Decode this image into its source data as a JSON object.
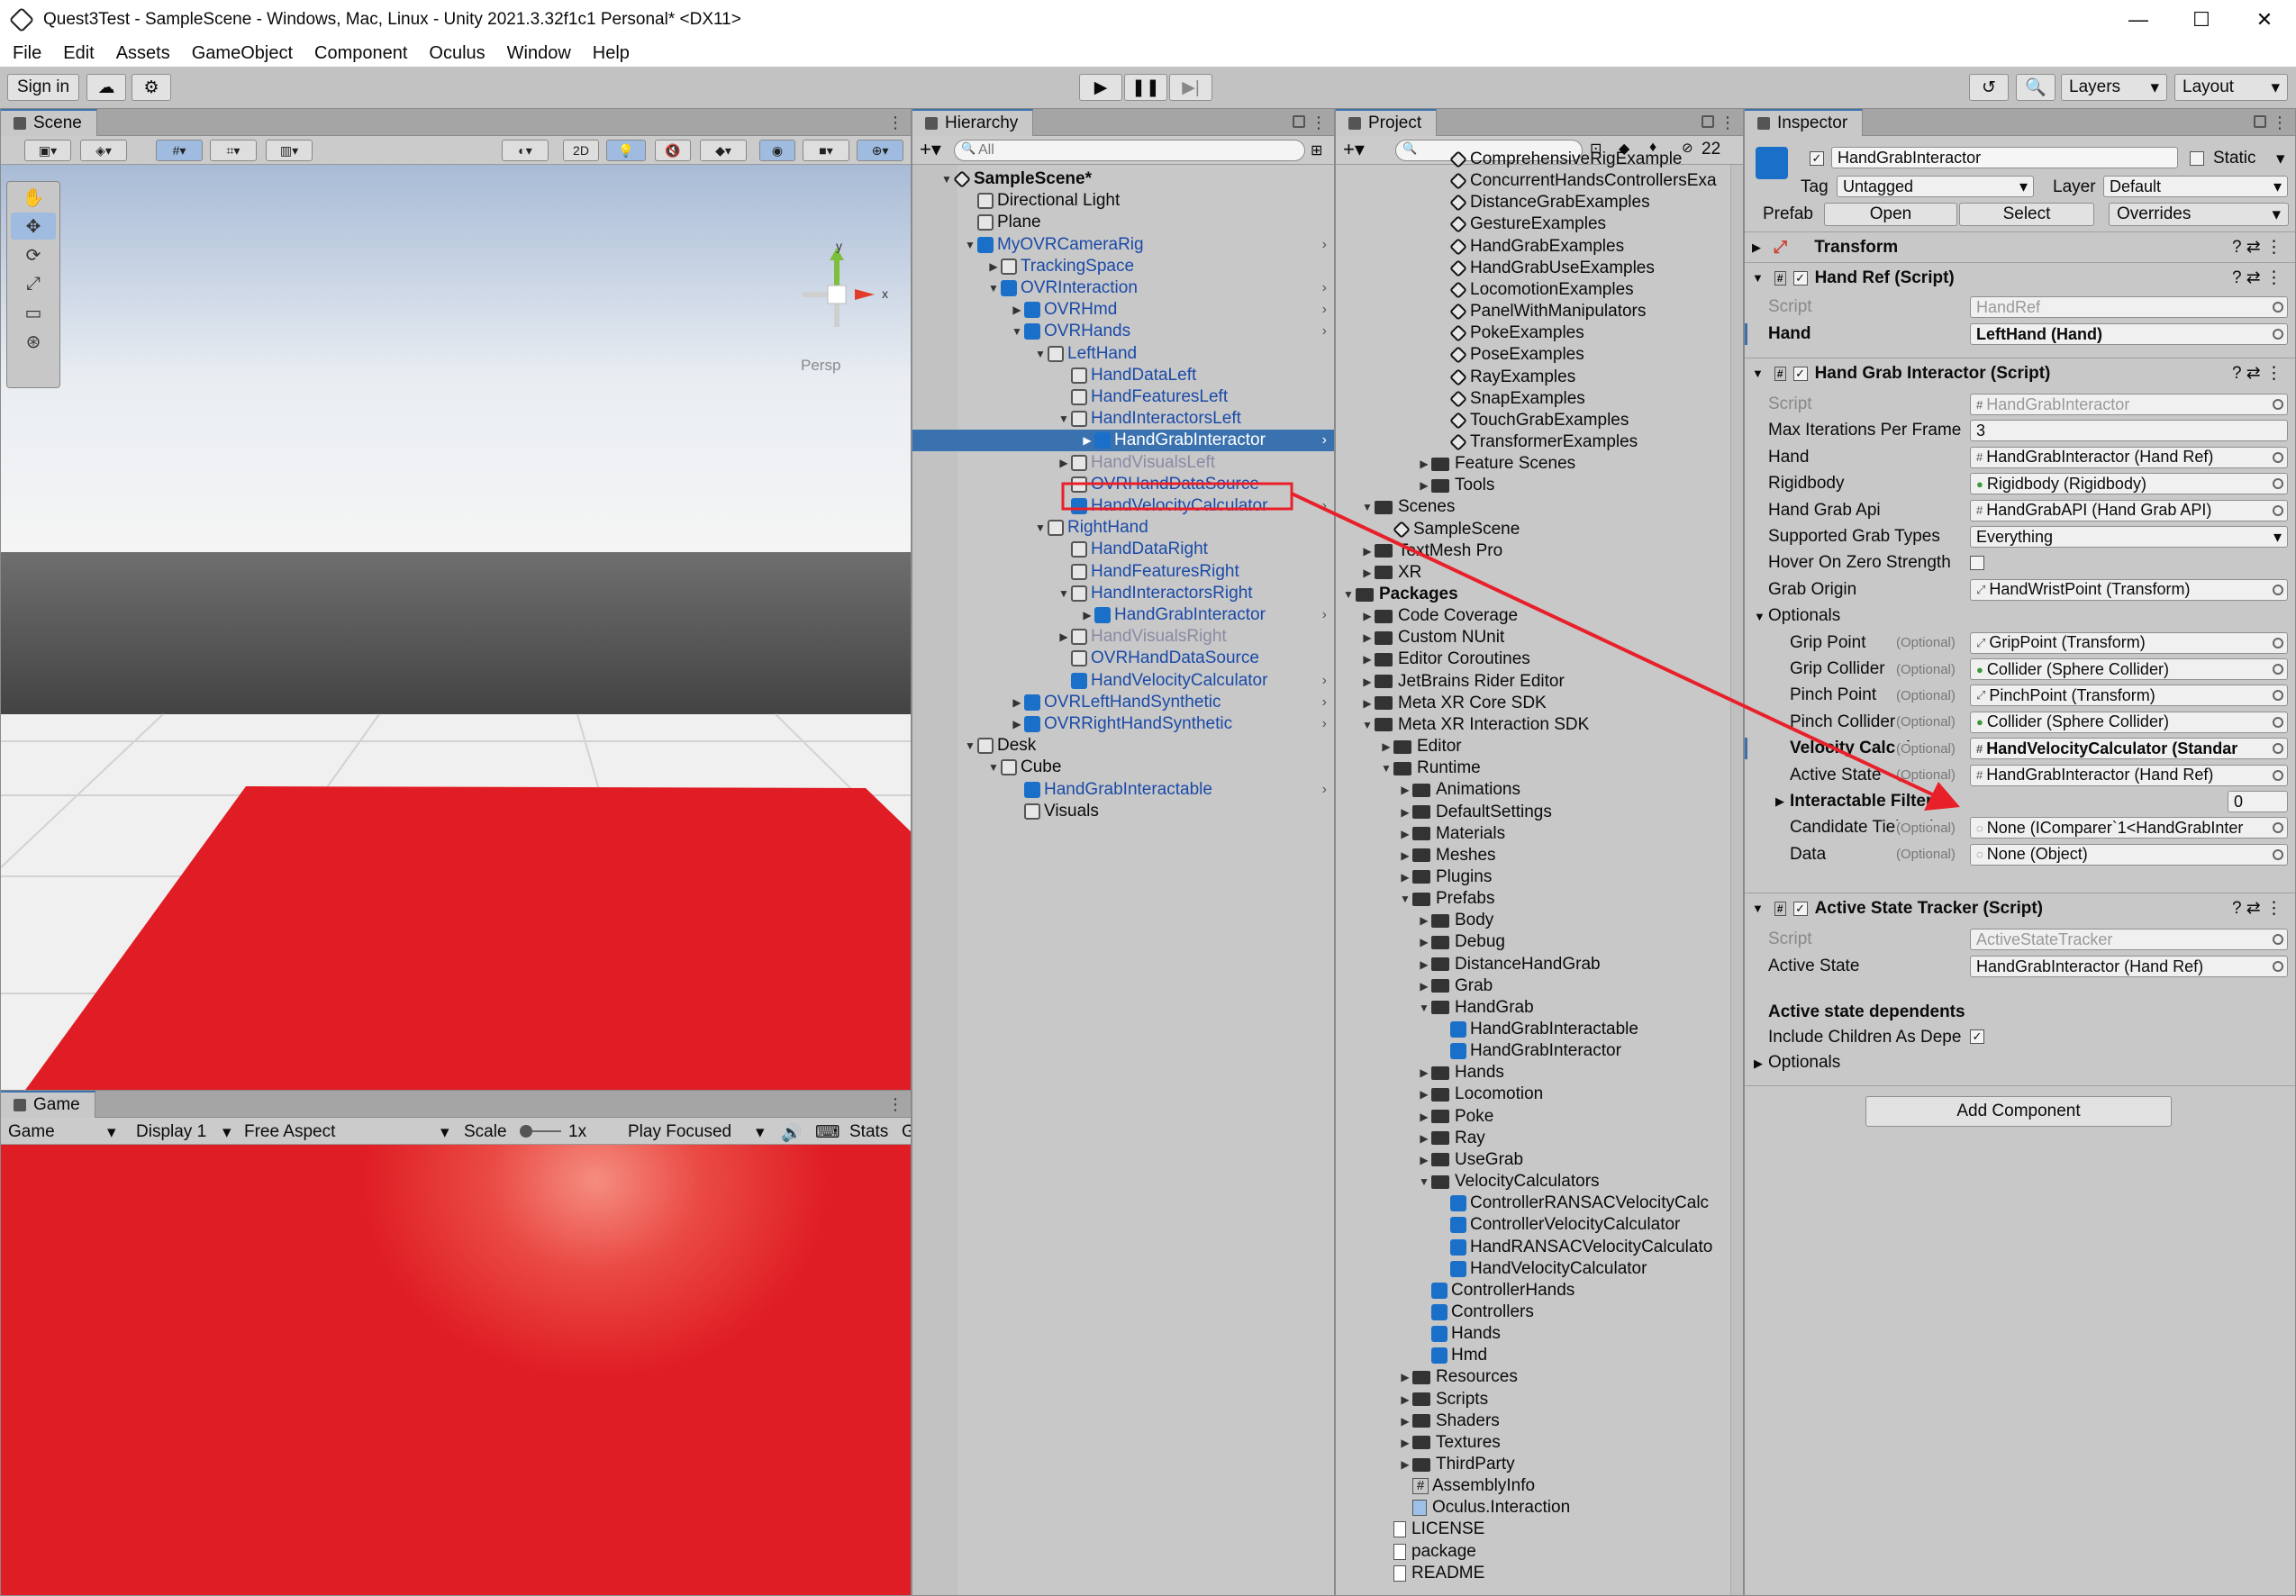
{
  "window": {
    "title": "Quest3Test - SampleScene - Windows, Mac, Linux - Unity 2021.3.32f1c1 Personal* <DX11>"
  },
  "menu": [
    "File",
    "Edit",
    "Assets",
    "GameObject",
    "Component",
    "Oculus",
    "Window",
    "Help"
  ],
  "toolbar": {
    "sign_in": "Sign in",
    "layers": "Layers",
    "layout": "Layout"
  },
  "scene": {
    "tab": "Scene",
    "mode_2d": "2D",
    "persp": "Persp",
    "axis_y": "y",
    "axis_x": "x"
  },
  "game": {
    "tab": "Game",
    "mode": "Game",
    "display": "Display 1",
    "aspect": "Free Aspect",
    "scale_label": "Scale",
    "scale_value": "1x",
    "play_focused": "Play Focused",
    "stats": "Stats",
    "gizmos": "G"
  },
  "hierarchy": {
    "tab": "Hierarchy",
    "search_placeholder": "All",
    "rows": [
      {
        "label": "SampleScene*",
        "indent": 0,
        "arrow": "▼",
        "icon": "unity",
        "style": "bold"
      },
      {
        "label": "Directional Light",
        "indent": 1,
        "arrow": "",
        "icon": "gobj",
        "style": ""
      },
      {
        "label": "Plane",
        "indent": 1,
        "arrow": "",
        "icon": "gobj",
        "style": ""
      },
      {
        "label": "MyOVRCameraRig",
        "indent": 1,
        "arrow": "▼",
        "icon": "cube",
        "style": "blue",
        "more": true
      },
      {
        "label": "TrackingSpace",
        "indent": 2,
        "arrow": "▶",
        "icon": "gobj",
        "style": "blue"
      },
      {
        "label": "OVRInteraction",
        "indent": 2,
        "arrow": "▼",
        "icon": "cube",
        "style": "blue",
        "more": true
      },
      {
        "label": "OVRHmd",
        "indent": 3,
        "arrow": "▶",
        "icon": "cube",
        "style": "blue",
        "more": true
      },
      {
        "label": "OVRHands",
        "indent": 3,
        "arrow": "▼",
        "icon": "cube",
        "style": "blue",
        "more": true
      },
      {
        "label": "LeftHand",
        "indent": 4,
        "arrow": "▼",
        "icon": "gobj",
        "style": "blue"
      },
      {
        "label": "HandDataLeft",
        "indent": 5,
        "arrow": "",
        "icon": "gobj",
        "style": "blue"
      },
      {
        "label": "HandFeaturesLeft",
        "indent": 5,
        "arrow": "",
        "icon": "gobj",
        "style": "blue"
      },
      {
        "label": "HandInteractorsLeft",
        "indent": 5,
        "arrow": "▼",
        "icon": "gobj",
        "style": "blue"
      },
      {
        "label": "HandGrabInteractor",
        "indent": 6,
        "arrow": "▶",
        "icon": "cube",
        "style": "sel",
        "more": true
      },
      {
        "label": "HandVisualsLeft",
        "indent": 5,
        "arrow": "▶",
        "icon": "gobj",
        "style": "dim"
      },
      {
        "label": "OVRHandDataSource",
        "indent": 5,
        "arrow": "",
        "icon": "gobj",
        "style": "blue"
      },
      {
        "label": "HandVelocityCalculator",
        "indent": 5,
        "arrow": "",
        "icon": "cube",
        "style": "blue boxed",
        "more": true
      },
      {
        "label": "RightHand",
        "indent": 4,
        "arrow": "▼",
        "icon": "gobj",
        "style": "blue"
      },
      {
        "label": "HandDataRight",
        "indent": 5,
        "arrow": "",
        "icon": "gobj",
        "style": "blue"
      },
      {
        "label": "HandFeaturesRight",
        "indent": 5,
        "arrow": "",
        "icon": "gobj",
        "style": "blue"
      },
      {
        "label": "HandInteractorsRight",
        "indent": 5,
        "arrow": "▼",
        "icon": "gobj",
        "style": "blue"
      },
      {
        "label": "HandGrabInteractor",
        "indent": 6,
        "arrow": "▶",
        "icon": "cube",
        "style": "blue",
        "more": true
      },
      {
        "label": "HandVisualsRight",
        "indent": 5,
        "arrow": "▶",
        "icon": "gobj",
        "style": "dim"
      },
      {
        "label": "OVRHandDataSource",
        "indent": 5,
        "arrow": "",
        "icon": "gobj",
        "style": "blue"
      },
      {
        "label": "HandVelocityCalculator",
        "indent": 5,
        "arrow": "",
        "icon": "cube",
        "style": "blue",
        "more": true
      },
      {
        "label": "OVRLeftHandSynthetic",
        "indent": 3,
        "arrow": "▶",
        "icon": "cube",
        "style": "blue",
        "more": true
      },
      {
        "label": "OVRRightHandSynthetic",
        "indent": 3,
        "arrow": "▶",
        "icon": "cube",
        "style": "blue",
        "more": true
      },
      {
        "label": "Desk",
        "indent": 1,
        "arrow": "▼",
        "icon": "gobj",
        "style": ""
      },
      {
        "label": "Cube",
        "indent": 2,
        "arrow": "▼",
        "icon": "gobj",
        "style": ""
      },
      {
        "label": "HandGrabInteractable",
        "indent": 3,
        "arrow": "",
        "icon": "cube",
        "style": "blue",
        "more": true
      },
      {
        "label": "Visuals",
        "indent": 3,
        "arrow": "",
        "icon": "gobj",
        "style": ""
      }
    ]
  },
  "project": {
    "tab": "Project",
    "hidden_count": "22",
    "rows": [
      {
        "label": "ComprehensiveRigExample",
        "indent": 5,
        "icon": "unity",
        "arrow": ""
      },
      {
        "label": "ConcurrentHandsControllersExa",
        "indent": 5,
        "icon": "unity",
        "arrow": ""
      },
      {
        "label": "DistanceGrabExamples",
        "indent": 5,
        "icon": "unity",
        "arrow": ""
      },
      {
        "label": "GestureExamples",
        "indent": 5,
        "icon": "unity",
        "arrow": ""
      },
      {
        "label": "HandGrabExamples",
        "indent": 5,
        "icon": "unity",
        "arrow": ""
      },
      {
        "label": "HandGrabUseExamples",
        "indent": 5,
        "icon": "unity",
        "arrow": ""
      },
      {
        "label": "LocomotionExamples",
        "indent": 5,
        "icon": "unity",
        "arrow": ""
      },
      {
        "label": "PanelWithManipulators",
        "indent": 5,
        "icon": "unity",
        "arrow": ""
      },
      {
        "label": "PokeExamples",
        "indent": 5,
        "icon": "unity",
        "arrow": ""
      },
      {
        "label": "PoseExamples",
        "indent": 5,
        "icon": "unity",
        "arrow": ""
      },
      {
        "label": "RayExamples",
        "indent": 5,
        "icon": "unity",
        "arrow": ""
      },
      {
        "label": "SnapExamples",
        "indent": 5,
        "icon": "unity",
        "arrow": ""
      },
      {
        "label": "TouchGrabExamples",
        "indent": 5,
        "icon": "unity",
        "arrow": ""
      },
      {
        "label": "TransformerExamples",
        "indent": 5,
        "icon": "unity",
        "arrow": ""
      },
      {
        "label": "Feature Scenes",
        "indent": 4,
        "icon": "folder",
        "arrow": "▶"
      },
      {
        "label": "Tools",
        "indent": 4,
        "icon": "folder",
        "arrow": "▶"
      },
      {
        "label": "Scenes",
        "indent": 1,
        "icon": "folder",
        "arrow": "▼"
      },
      {
        "label": "SampleScene",
        "indent": 2,
        "icon": "unity",
        "arrow": ""
      },
      {
        "label": "TextMesh Pro",
        "indent": 1,
        "icon": "folder",
        "arrow": "▶"
      },
      {
        "label": "XR",
        "indent": 1,
        "icon": "folder",
        "arrow": "▶"
      },
      {
        "label": "Packages",
        "indent": 0,
        "icon": "folder",
        "arrow": "▼",
        "bold": true
      },
      {
        "label": "Code Coverage",
        "indent": 1,
        "icon": "folder",
        "arrow": "▶"
      },
      {
        "label": "Custom NUnit",
        "indent": 1,
        "icon": "folder",
        "arrow": "▶"
      },
      {
        "label": "Editor Coroutines",
        "indent": 1,
        "icon": "folder",
        "arrow": "▶"
      },
      {
        "label": "JetBrains Rider Editor",
        "indent": 1,
        "icon": "folder",
        "arrow": "▶"
      },
      {
        "label": "Meta XR Core SDK",
        "indent": 1,
        "icon": "folder",
        "arrow": "▶"
      },
      {
        "label": "Meta XR Interaction SDK",
        "indent": 1,
        "icon": "folder",
        "arrow": "▼"
      },
      {
        "label": "Editor",
        "indent": 2,
        "icon": "folder",
        "arrow": "▶"
      },
      {
        "label": "Runtime",
        "indent": 2,
        "icon": "folder",
        "arrow": "▼"
      },
      {
        "label": "Animations",
        "indent": 3,
        "icon": "folder",
        "arrow": "▶"
      },
      {
        "label": "DefaultSettings",
        "indent": 3,
        "icon": "folder",
        "arrow": "▶"
      },
      {
        "label": "Materials",
        "indent": 3,
        "icon": "folder",
        "arrow": "▶"
      },
      {
        "label": "Meshes",
        "indent": 3,
        "icon": "folder",
        "arrow": "▶"
      },
      {
        "label": "Plugins",
        "indent": 3,
        "icon": "folder",
        "arrow": "▶"
      },
      {
        "label": "Prefabs",
        "indent": 3,
        "icon": "folder",
        "arrow": "▼"
      },
      {
        "label": "Body",
        "indent": 4,
        "icon": "folder",
        "arrow": "▶"
      },
      {
        "label": "Debug",
        "indent": 4,
        "icon": "folder",
        "arrow": "▶"
      },
      {
        "label": "DistanceHandGrab",
        "indent": 4,
        "icon": "folder",
        "arrow": "▶"
      },
      {
        "label": "Grab",
        "indent": 4,
        "icon": "folder",
        "arrow": "▶"
      },
      {
        "label": "HandGrab",
        "indent": 4,
        "icon": "folder",
        "arrow": "▼"
      },
      {
        "label": "HandGrabInteractable",
        "indent": 5,
        "icon": "cube",
        "arrow": ""
      },
      {
        "label": "HandGrabInteractor",
        "indent": 5,
        "icon": "cube",
        "arrow": ""
      },
      {
        "label": "Hands",
        "indent": 4,
        "icon": "folder",
        "arrow": "▶"
      },
      {
        "label": "Locomotion",
        "indent": 4,
        "icon": "folder",
        "arrow": "▶"
      },
      {
        "label": "Poke",
        "indent": 4,
        "icon": "folder",
        "arrow": "▶"
      },
      {
        "label": "Ray",
        "indent": 4,
        "icon": "folder",
        "arrow": "▶"
      },
      {
        "label": "UseGrab",
        "indent": 4,
        "icon": "folder",
        "arrow": "▶"
      },
      {
        "label": "VelocityCalculators",
        "indent": 4,
        "icon": "folder",
        "arrow": "▼"
      },
      {
        "label": "ControllerRANSACVelocityCalc",
        "indent": 5,
        "icon": "cube",
        "arrow": ""
      },
      {
        "label": "ControllerVelocityCalculator",
        "indent": 5,
        "icon": "cube",
        "arrow": ""
      },
      {
        "label": "HandRANSACVelocityCalculato",
        "indent": 5,
        "icon": "cube",
        "arrow": ""
      },
      {
        "label": "HandVelocityCalculator",
        "indent": 5,
        "icon": "cube",
        "arrow": ""
      },
      {
        "label": "ControllerHands",
        "indent": 4,
        "icon": "cube",
        "arrow": ""
      },
      {
        "label": "Controllers",
        "indent": 4,
        "icon": "cube",
        "arrow": ""
      },
      {
        "label": "Hands",
        "indent": 4,
        "icon": "cube",
        "arrow": ""
      },
      {
        "label": "Hmd",
        "indent": 4,
        "icon": "cube",
        "arrow": ""
      },
      {
        "label": "Resources",
        "indent": 3,
        "icon": "folder",
        "arrow": "▶"
      },
      {
        "label": "Scripts",
        "indent": 3,
        "icon": "folder",
        "arrow": "▶"
      },
      {
        "label": "Shaders",
        "indent": 3,
        "icon": "folder",
        "arrow": "▶"
      },
      {
        "label": "Textures",
        "indent": 3,
        "icon": "folder",
        "arrow": "▶"
      },
      {
        "label": "ThirdParty",
        "indent": 3,
        "icon": "folder",
        "arrow": "▶"
      },
      {
        "label": "AssemblyInfo",
        "indent": 3,
        "icon": "script",
        "arrow": ""
      },
      {
        "label": "Oculus.Interaction",
        "indent": 3,
        "icon": "asm",
        "arrow": ""
      },
      {
        "label": "LICENSE",
        "indent": 2,
        "icon": "doc",
        "arrow": ""
      },
      {
        "label": "package",
        "indent": 2,
        "icon": "doc",
        "arrow": ""
      },
      {
        "label": "README",
        "indent": 2,
        "icon": "doc",
        "arrow": ""
      }
    ]
  },
  "inspector": {
    "tab": "Inspector",
    "object_name": "HandGrabInteractor",
    "static_label": "Static",
    "tag_label": "Tag",
    "tag_value": "Untagged",
    "layer_label": "Layer",
    "layer_value": "Default",
    "prefab_label": "Prefab",
    "prefab_open": "Open",
    "prefab_select": "Select",
    "prefab_overrides": "Overrides",
    "transform": "Transform",
    "hand_ref": {
      "title": "Hand Ref (Script)",
      "script_label": "Script",
      "script_value": "HandRef",
      "hand_label": "Hand",
      "hand_value": "LeftHand (Hand)"
    },
    "hgi": {
      "title": "Hand Grab Interactor (Script)",
      "fields": [
        {
          "label": "Script",
          "value": "HandGrabInteractor",
          "opt": "",
          "kind": "disabled"
        },
        {
          "label": "Max Iterations Per Frame",
          "value": "3",
          "opt": "",
          "kind": "text"
        },
        {
          "label": "Hand",
          "value": "HandGrabInteractor (Hand Ref)",
          "opt": "",
          "kind": "ref"
        },
        {
          "label": "Rigidbody",
          "value": "Rigidbody (Rigidbody)",
          "opt": "",
          "kind": "ref"
        },
        {
          "label": "Hand Grab Api",
          "value": "HandGrabAPI (Hand Grab API)",
          "opt": "",
          "kind": "ref"
        },
        {
          "label": "Supported Grab Types",
          "value": "Everything",
          "opt": "",
          "kind": "dropdown"
        },
        {
          "label": "Hover On Zero Strength",
          "value": "",
          "opt": "",
          "kind": "checkbox"
        },
        {
          "label": "Grab Origin",
          "value": "HandWristPoint (Transform)",
          "opt": "",
          "kind": "ref"
        },
        {
          "label": "Optionals",
          "value": "",
          "opt": "",
          "kind": "foldout"
        },
        {
          "label": "Grip Point",
          "value": "GripPoint (Transform)",
          "opt": "(Optional)",
          "kind": "ref"
        },
        {
          "label": "Grip Collider",
          "value": "Collider (Sphere Collider)",
          "opt": "(Optional)",
          "kind": "ref"
        },
        {
          "label": "Pinch Point",
          "value": "PinchPoint (Transform)",
          "opt": "(Optional)",
          "kind": "ref"
        },
        {
          "label": "Pinch Collider",
          "value": "Collider (Sphere Collider)",
          "opt": "(Optional)",
          "kind": "ref"
        },
        {
          "label": "Velocity Calculator",
          "value": "HandVelocityCalculator (Standar",
          "opt": "(Optional)",
          "kind": "ref-bold"
        },
        {
          "label": "Active State",
          "value": "HandGrabInteractor (Hand Ref)",
          "opt": "(Optional)",
          "kind": "ref"
        },
        {
          "label": "Interactable Filters",
          "value": "0",
          "opt": "",
          "kind": "count"
        },
        {
          "label": "Candidate Tiebreaker",
          "value": "None (IComparer`1<HandGrabInter",
          "opt": "(Optional)",
          "kind": "ref"
        },
        {
          "label": "Data",
          "value": "None (Object)",
          "opt": "(Optional)",
          "kind": "ref"
        }
      ]
    },
    "ast": {
      "title": "Active State Tracker (Script)",
      "script_label": "Script",
      "script_value": "ActiveStateTracker",
      "active_label": "Active State",
      "active_value": "HandGrabInteractor (Hand Ref)",
      "dependents": "Active state dependents",
      "include_children": "Include Children As Depe",
      "optionals": "Optionals"
    },
    "add_component": "Add Component"
  },
  "colors": {
    "selection": "#3a72b0",
    "red_plane": "#e01c24",
    "annotation": "#e8202a"
  }
}
